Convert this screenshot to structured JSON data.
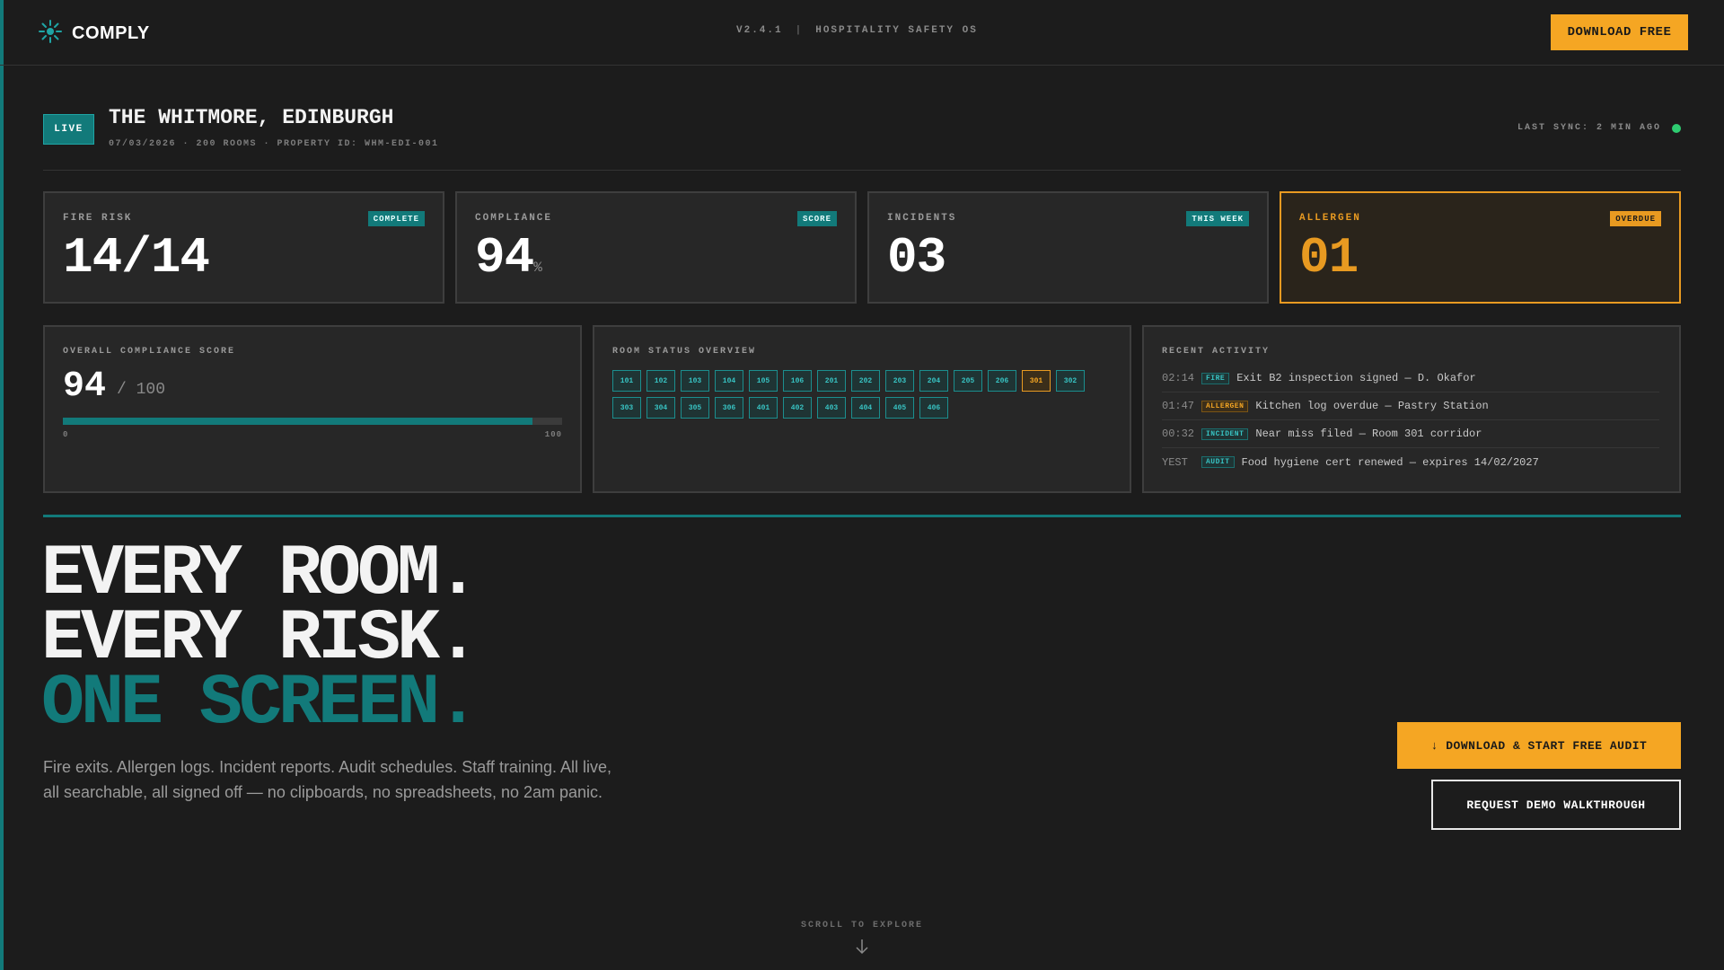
{
  "app": {
    "name": "COMPLY",
    "version": "V2.4.1",
    "tagline": "HOSPITALITY SAFETY OS",
    "download_label": "DOWNLOAD FREE"
  },
  "property": {
    "live_label": "LIVE",
    "name": "THE WHITMORE, EDINBURGH",
    "meta": "07/03/2026 · 200 ROOMS · PROPERTY ID: WHM-EDI-001",
    "sync_label": "LAST SYNC: 2 MIN AGO",
    "sync_color": "#2ecc71"
  },
  "kpis": [
    {
      "label": "FIRE RISK",
      "tag": "COMPLETE",
      "value": "14/14",
      "unit": ""
    },
    {
      "label": "COMPLIANCE",
      "tag": "SCORE",
      "value": "94",
      "unit": "%"
    },
    {
      "label": "INCIDENTS",
      "tag": "THIS WEEK",
      "value": "03",
      "unit": ""
    },
    {
      "label": "ALLERGEN",
      "tag": "OVERDUE",
      "value": "01",
      "unit": ""
    }
  ],
  "compliance_score": {
    "title": "OVERALL COMPLIANCE SCORE",
    "value": "94",
    "max_label": "/ 100",
    "fill_fraction": 0.94,
    "scale_min": "0",
    "scale_max": "100"
  },
  "room_status": {
    "title": "ROOM STATUS OVERVIEW",
    "rooms": [
      {
        "id": "101",
        "status": "ok"
      },
      {
        "id": "102",
        "status": "ok"
      },
      {
        "id": "103",
        "status": "ok"
      },
      {
        "id": "104",
        "status": "ok"
      },
      {
        "id": "105",
        "status": "ok"
      },
      {
        "id": "106",
        "status": "ok"
      },
      {
        "id": "201",
        "status": "ok"
      },
      {
        "id": "202",
        "status": "ok"
      },
      {
        "id": "203",
        "status": "ok"
      },
      {
        "id": "204",
        "status": "ok"
      },
      {
        "id": "205",
        "status": "ok"
      },
      {
        "id": "206",
        "status": "ok"
      },
      {
        "id": "301",
        "status": "warn"
      },
      {
        "id": "302",
        "status": "ok"
      },
      {
        "id": "303",
        "status": "ok"
      },
      {
        "id": "304",
        "status": "ok"
      },
      {
        "id": "305",
        "status": "ok"
      },
      {
        "id": "306",
        "status": "ok"
      },
      {
        "id": "401",
        "status": "ok"
      },
      {
        "id": "402",
        "status": "ok"
      },
      {
        "id": "403",
        "status": "ok"
      },
      {
        "id": "404",
        "status": "ok"
      },
      {
        "id": "405",
        "status": "ok"
      },
      {
        "id": "406",
        "status": "ok"
      }
    ]
  },
  "activity": {
    "title": "RECENT ACTIVITY",
    "items": [
      {
        "time": "02:14",
        "tag": "FIRE",
        "kind": "fire",
        "text": "Exit B2 inspection signed — D. Okafor"
      },
      {
        "time": "01:47",
        "tag": "ALLERGEN",
        "kind": "allergen",
        "text": "Kitchen log overdue — Pastry Station"
      },
      {
        "time": "00:32",
        "tag": "INCIDENT",
        "kind": "incident",
        "text": "Near miss filed — Room 301 corridor"
      },
      {
        "time": "YEST",
        "tag": "AUDIT",
        "kind": "audit",
        "text": "Food hygiene cert renewed — expires 14/02/2027"
      }
    ]
  },
  "hero": {
    "line1": "EVERY ROOM.",
    "line2": "EVERY RISK.",
    "line3": "ONE SCREEN.",
    "copy": "Fire exits. Allergen logs. Incident reports. Audit schedules. Staff training. All live, all searchable, all signed off — no clipboards, no spreadsheets, no 2am panic.",
    "cta_primary": "↓ DOWNLOAD & START FREE AUDIT",
    "cta_secondary": "REQUEST DEMO WALKTHROUGH"
  },
  "scroll_hint": "SCROLL TO EXPLORE",
  "colors": {
    "accent": "#127a7a",
    "warning": "#f5a623",
    "background": "#1c1c1c"
  }
}
